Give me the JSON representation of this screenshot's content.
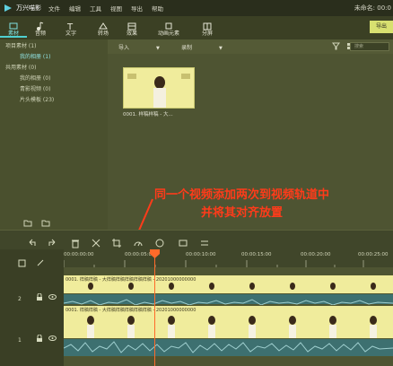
{
  "app": {
    "name": "万兴喵影",
    "menu": [
      "文件",
      "编辑",
      "工具",
      "视图",
      "导出",
      "帮助"
    ],
    "project_status": "未命名: 00:0"
  },
  "toolbar": {
    "tools": [
      {
        "label": "素材",
        "icon": "media-icon"
      },
      {
        "label": "音频",
        "icon": "music-icon"
      },
      {
        "label": "文字",
        "icon": "text-icon"
      },
      {
        "label": "转场",
        "icon": "transition-icon"
      },
      {
        "label": "效果",
        "icon": "effects-icon"
      },
      {
        "label": "动画元素",
        "icon": "elements-icon"
      },
      {
        "label": "分屏",
        "icon": "split-screen-icon"
      }
    ],
    "export_label": "导出"
  },
  "left_panel": {
    "items": [
      {
        "label": "项目素材 (1)"
      },
      {
        "label": "我的相册 (1)"
      },
      {
        "label": "共用素材 (0)"
      },
      {
        "label": "我的相册 (0)"
      },
      {
        "label": "青影视频 (0)"
      },
      {
        "label": "片头模板 (23)"
      }
    ]
  },
  "media": {
    "import_label": "导入",
    "record_label": "录制",
    "search_placeholder": "搜索",
    "clip_name": "0001. 样稿样稿 - 大..."
  },
  "annotation": {
    "line1": "同一个视频添加两次到视频轨道中",
    "line2": "并将其对齐放置"
  },
  "timeline": {
    "ruler_labels": [
      "00:00:00:00",
      "00:00:05:00",
      "00:00:10:00",
      "00:00:15:00",
      "00:00:20:00",
      "00:00:25:00"
    ],
    "track2_label": "2",
    "track1_label": "1",
    "track2_clip_title": "0001. 样稿样稿 - 大样稿样稿样稿样稿样稿 - 20201000000000",
    "track1_clip_title": "0001. 样稿样稿 - 大样稿样稿样稿样稿样稿 - 20201000000000"
  },
  "colors": {
    "accent": "#4fd0d0",
    "annotation": "#ff3b1a",
    "playhead": "#ff6a2a",
    "clip_fill": "#f0ec9c"
  }
}
